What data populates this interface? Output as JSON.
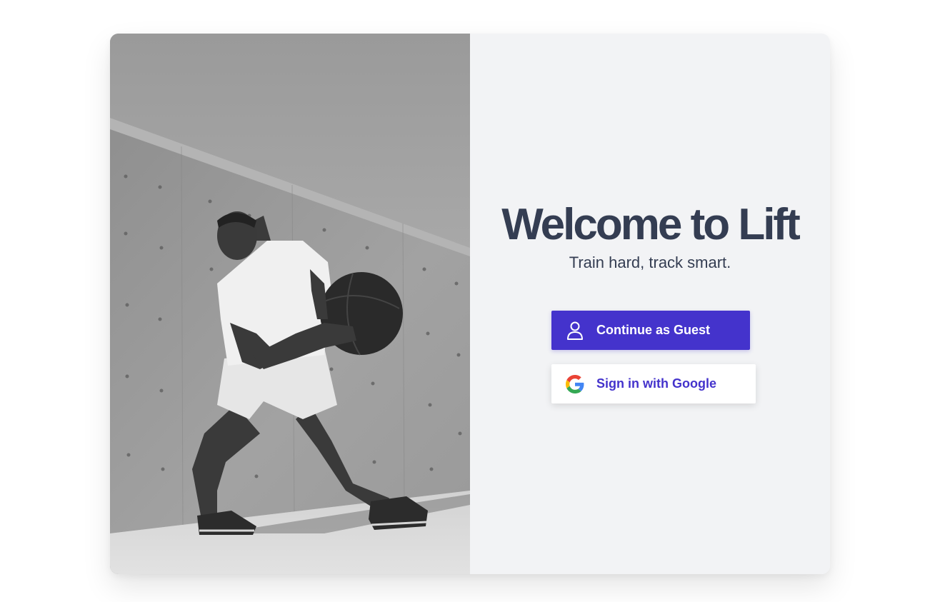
{
  "welcome": {
    "title": "Welcome to Lift",
    "subtitle": "Train hard, track smart."
  },
  "actions": {
    "guest_label": "Continue as Guest",
    "google_label": "Sign in with Google"
  },
  "icons": {
    "guest": "user-icon",
    "google": "google-logo-icon"
  },
  "colors": {
    "accent": "#4433cc",
    "title_text": "#343d52",
    "panel_bg": "#f2f3f5"
  }
}
